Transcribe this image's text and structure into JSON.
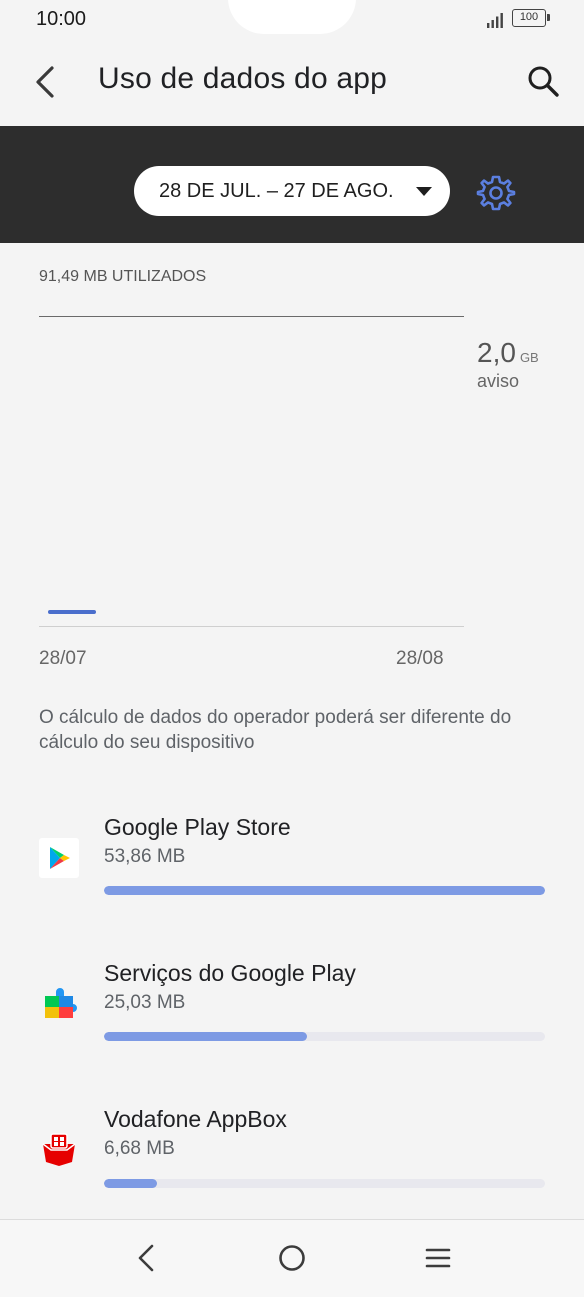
{
  "status_bar": {
    "time": "10:00",
    "battery": "100",
    "signal_icon": "signal-bars-icon"
  },
  "header": {
    "title": "Uso de dados do app",
    "back_icon": "chevron-left-icon",
    "search_icon": "search-icon"
  },
  "cycle": {
    "label": "28 DE JUL. – 27 DE AGO.",
    "caret_icon": "caret-down-icon",
    "settings_icon": "gear-icon"
  },
  "chart": {
    "usage_total": "91,49 MB UTILIZADOS",
    "warning_value": "2,0",
    "warning_unit": "GB",
    "warning_label": "aviso",
    "start_date": "28/07",
    "end_date": "28/08"
  },
  "note": "O cálculo de dados do operador poderá ser diferente do cálculo do seu dispositivo",
  "apps": [
    {
      "name": "Google Play Store",
      "size": "53,86 MB",
      "usage_fraction": 1.0,
      "icon": "google-play-store-icon"
    },
    {
      "name": "Serviços do Google Play",
      "size": "25,03 MB",
      "usage_fraction": 0.46,
      "icon": "google-play-services-icon"
    },
    {
      "name": "Vodafone AppBox",
      "size": "6,68 MB",
      "usage_fraction": 0.12,
      "icon": "vodafone-appbox-icon"
    }
  ],
  "colors": {
    "accent": "#4a6ecc",
    "bar_fill": "#7d9ae4",
    "band": "#2d2d2d"
  },
  "nav": {
    "back_icon": "nav-back-icon",
    "home_icon": "nav-home-icon",
    "menu_icon": "nav-menu-icon"
  }
}
